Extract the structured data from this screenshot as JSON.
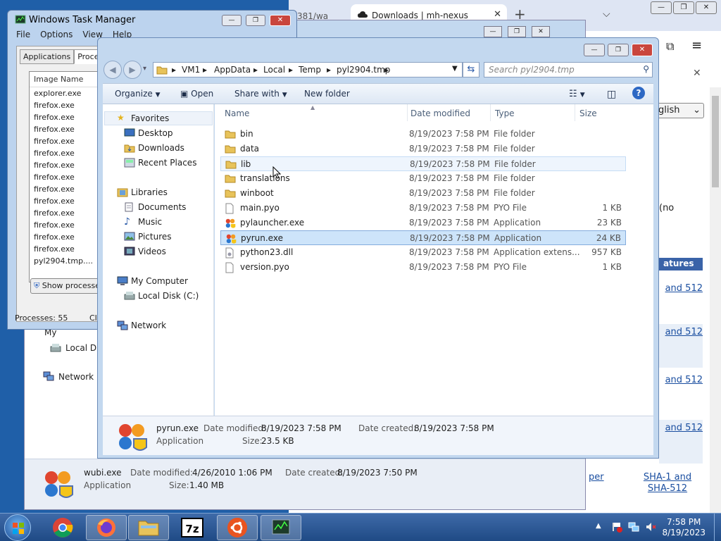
{
  "browser": {
    "tab1_text": "381/wa",
    "tab2_title": "Downloads | mh-nexus",
    "language": "glish",
    "no_text": "(no",
    "features_header": "atures",
    "sha_label": "SHA-1 and SHA-512",
    "sha_short": "and 512",
    "per_text": "per"
  },
  "taskmgr": {
    "title": "Windows Task Manager",
    "menu": [
      "File",
      "Options",
      "View",
      "Help"
    ],
    "tabs": [
      "Applications",
      "Processes"
    ],
    "col_image_name": "Image Name",
    "processes": [
      "explorer.exe",
      "firefox.exe",
      "firefox.exe",
      "firefox.exe",
      "firefox.exe",
      "firefox.exe",
      "firefox.exe",
      "firefox.exe",
      "firefox.exe",
      "firefox.exe",
      "firefox.exe",
      "firefox.exe",
      "firefox.exe",
      "firefox.exe",
      "pyl2904.tmp...."
    ],
    "show_processes_btn": "Show processes",
    "status_processes": "Processes: 55",
    "status_cpu": "CI"
  },
  "bgexplorer": {
    "nav_my_computer": "My",
    "nav_local_disk": "Local Dis",
    "nav_network": "Network",
    "file_name": "wubi.exe",
    "file_type": "Application",
    "date_modified_label": "Date modified:",
    "date_modified": "4/26/2010 1:06 PM",
    "date_created_label": "Date created:",
    "date_created": "8/19/2023 7:50 PM",
    "size_label": "Size:",
    "size": "1.40 MB"
  },
  "explorer": {
    "breadcrumb": [
      "VM1",
      "AppData",
      "Local",
      "Temp",
      "pyl2904.tmp"
    ],
    "search_placeholder": "Search pyl2904.tmp",
    "toolbar": {
      "organize": "Organize",
      "open": "Open",
      "share_with": "Share with",
      "new_folder": "New folder"
    },
    "nav": {
      "favorites": "Favorites",
      "desktop": "Desktop",
      "downloads": "Downloads",
      "recent_places": "Recent Places",
      "libraries": "Libraries",
      "documents": "Documents",
      "music": "Music",
      "pictures": "Pictures",
      "videos": "Videos",
      "my_computer": "My Computer",
      "local_disk": "Local Disk (C:)",
      "network": "Network"
    },
    "columns": {
      "name": "Name",
      "date_modified": "Date modified",
      "type": "Type",
      "size": "Size"
    },
    "files": [
      {
        "name": "bin",
        "date": "8/19/2023 7:58 PM",
        "type": "File folder",
        "size": "",
        "icon": "folder"
      },
      {
        "name": "data",
        "date": "8/19/2023 7:58 PM",
        "type": "File folder",
        "size": "",
        "icon": "folder"
      },
      {
        "name": "lib",
        "date": "8/19/2023 7:58 PM",
        "type": "File folder",
        "size": "",
        "icon": "folder"
      },
      {
        "name": "translations",
        "date": "8/19/2023 7:58 PM",
        "type": "File folder",
        "size": "",
        "icon": "folder"
      },
      {
        "name": "winboot",
        "date": "8/19/2023 7:58 PM",
        "type": "File folder",
        "size": "",
        "icon": "folder"
      },
      {
        "name": "main.pyo",
        "date": "8/19/2023 7:58 PM",
        "type": "PYO File",
        "size": "1 KB",
        "icon": "file"
      },
      {
        "name": "pylauncher.exe",
        "date": "8/19/2023 7:58 PM",
        "type": "Application",
        "size": "23 KB",
        "icon": "app"
      },
      {
        "name": "pyrun.exe",
        "date": "8/19/2023 7:58 PM",
        "type": "Application",
        "size": "24 KB",
        "icon": "app"
      },
      {
        "name": "python23.dll",
        "date": "8/19/2023 7:58 PM",
        "type": "Application extens...",
        "size": "957 KB",
        "icon": "dll"
      },
      {
        "name": "version.pyo",
        "date": "8/19/2023 7:58 PM",
        "type": "PYO File",
        "size": "1 KB",
        "icon": "file"
      }
    ],
    "details": {
      "file_name": "pyrun.exe",
      "file_type": "Application",
      "date_modified_label": "Date modified:",
      "date_modified": "8/19/2023 7:58 PM",
      "date_created_label": "Date created:",
      "date_created": "8/19/2023 7:58 PM",
      "size_label": "Size:",
      "size": "23.5 KB"
    }
  },
  "taskbar": {
    "time": "7:58 PM",
    "date": "8/19/2023"
  }
}
